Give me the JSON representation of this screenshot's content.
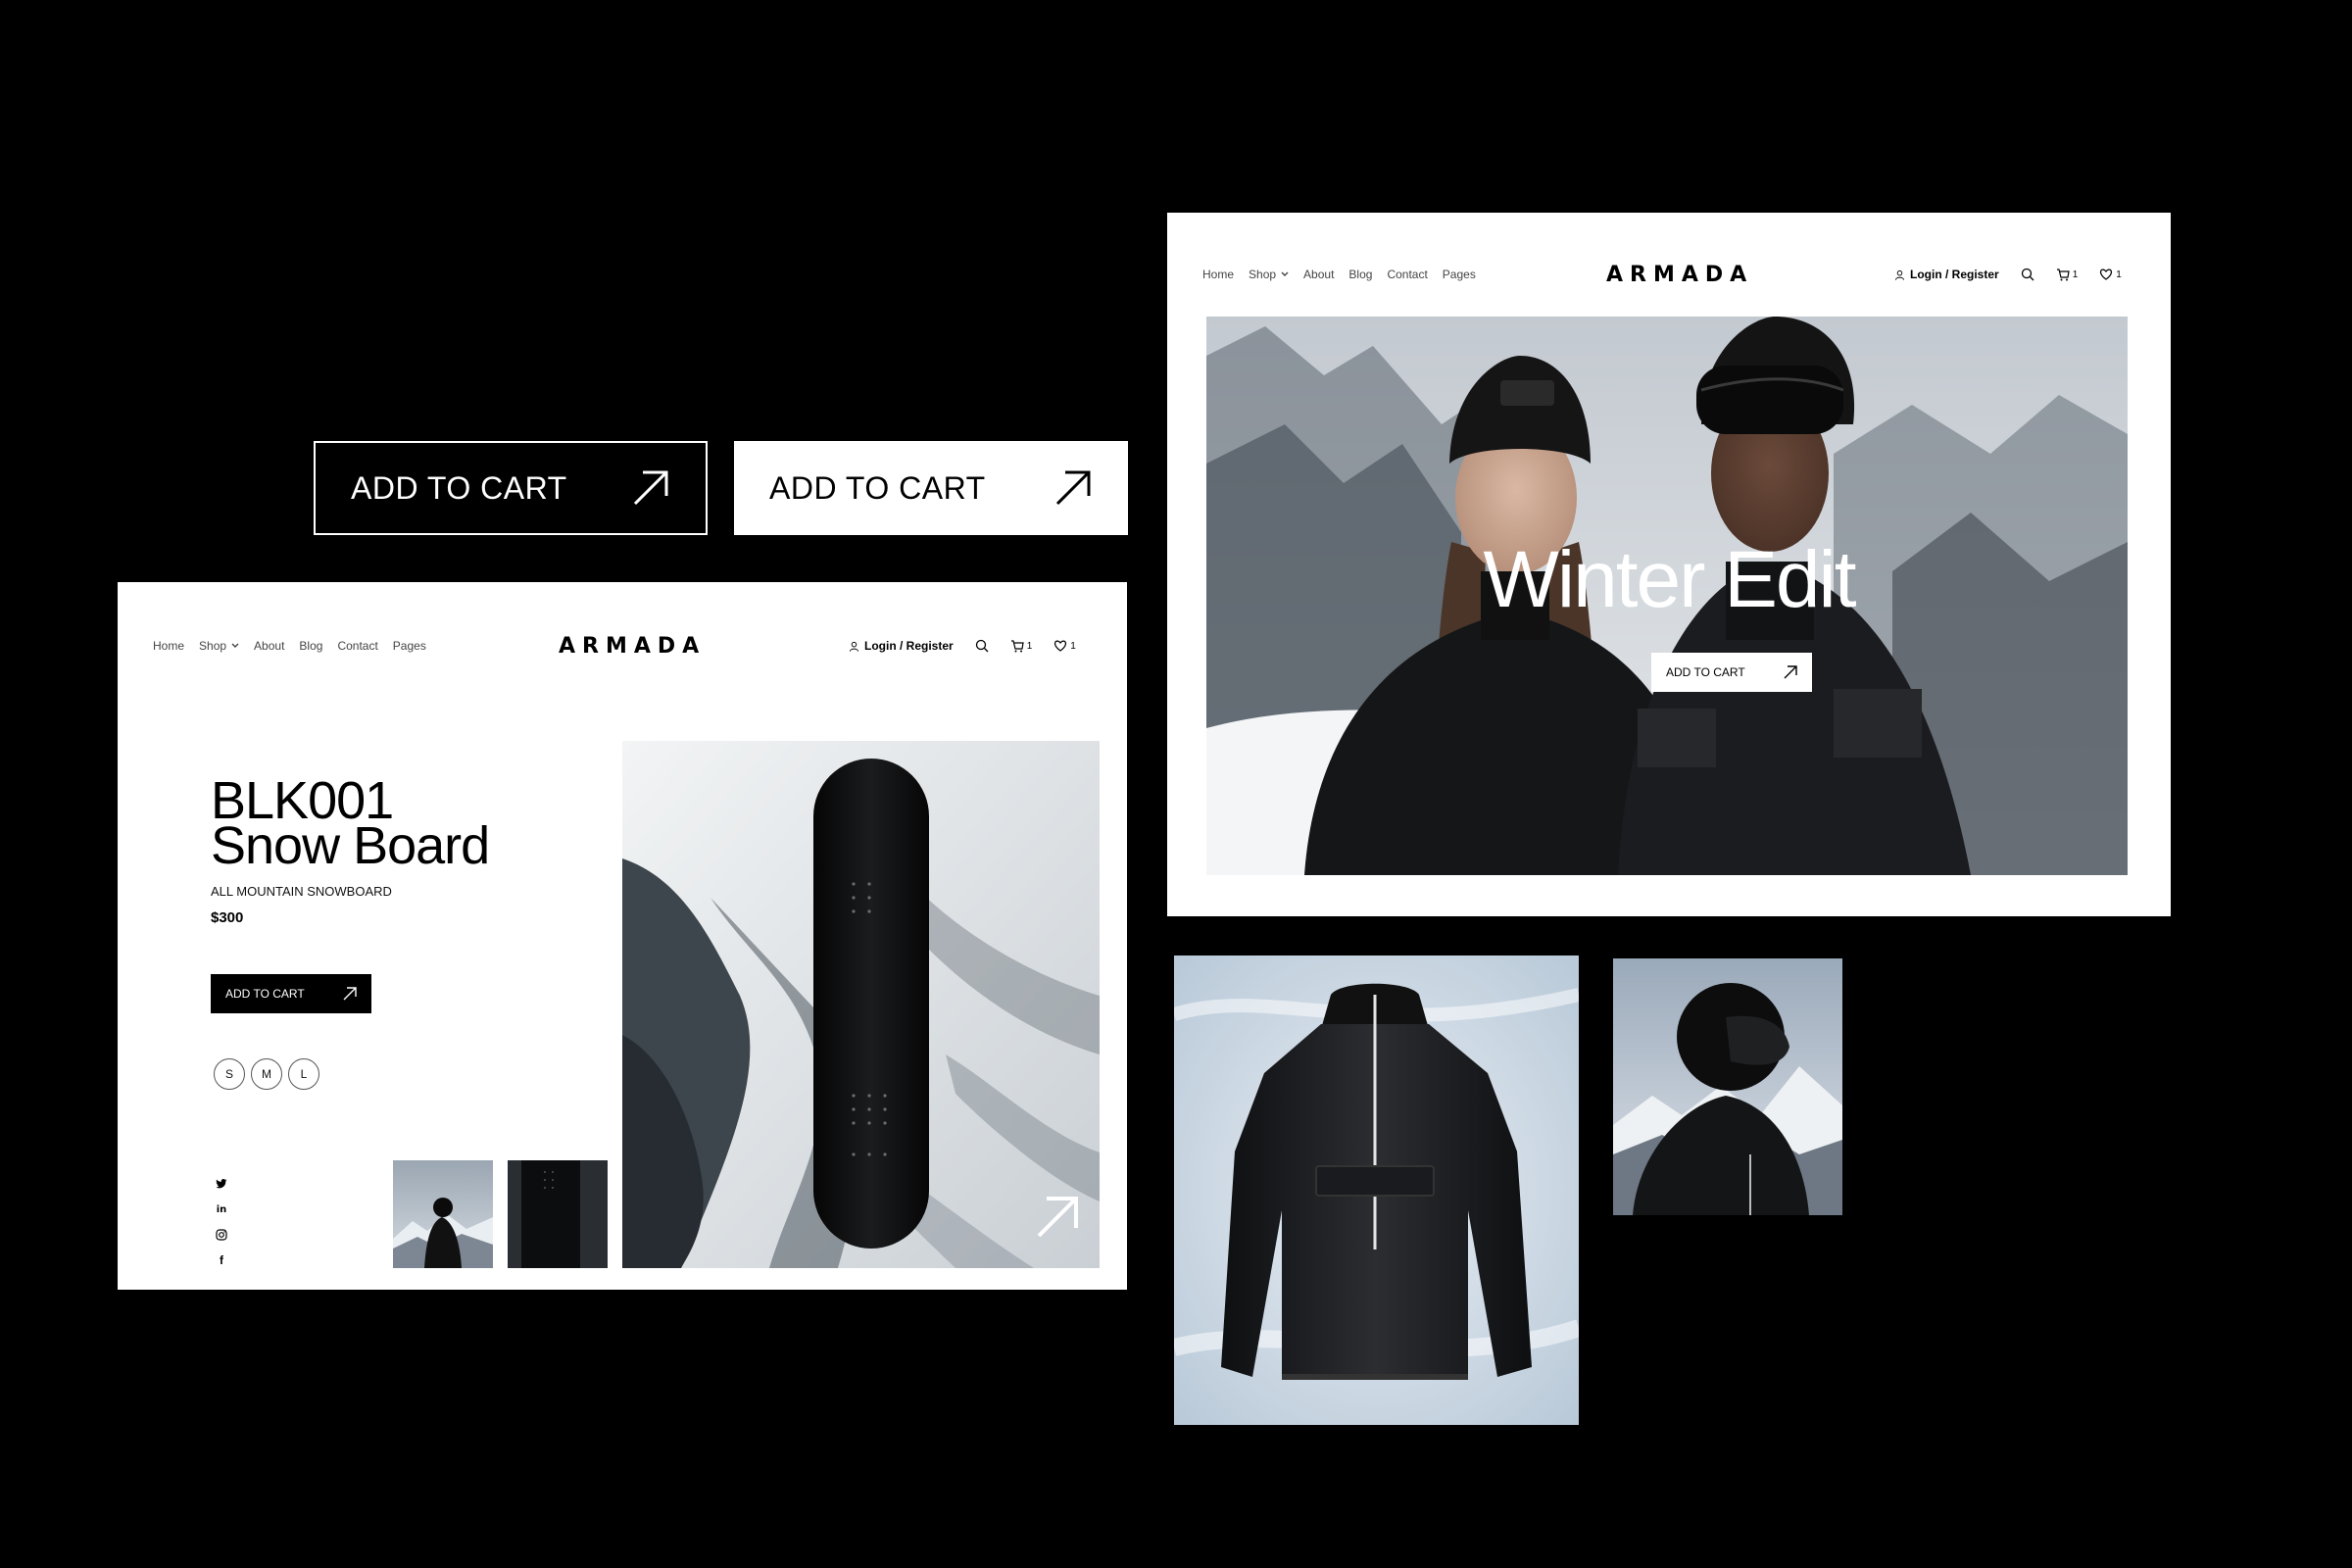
{
  "standalone_buttons": {
    "outline_label": "ADD TO CART",
    "solid_label": "ADD TO CART"
  },
  "product_page": {
    "nav": {
      "items": [
        "Home",
        "Shop",
        "About",
        "Blog",
        "Contact",
        "Pages"
      ],
      "logo": "ARMADA",
      "login": "Login / Register",
      "cart_count": "1",
      "wishlist_count": "1"
    },
    "title_line1": "BLK001",
    "title_line2": "Snow Board",
    "subtitle": "ALL MOUNTAIN SNOWBOARD",
    "price": "$300",
    "cta": "ADD TO CART",
    "sizes": [
      "S",
      "M",
      "L"
    ],
    "socials": [
      "twitter-icon",
      "linkedin-icon",
      "instagram-icon",
      "facebook-icon"
    ]
  },
  "hero_page": {
    "nav": {
      "items": [
        "Home",
        "Shop",
        "About",
        "Blog",
        "Contact",
        "Pages"
      ],
      "logo": "ARMADA",
      "login": "Login / Register",
      "cart_count": "1",
      "wishlist_count": "1"
    },
    "headline": "Winter Edit",
    "cta": "ADD TO CART"
  },
  "colors": {
    "background": "#000000",
    "panel": "#ffffff",
    "accent": "#000000"
  }
}
